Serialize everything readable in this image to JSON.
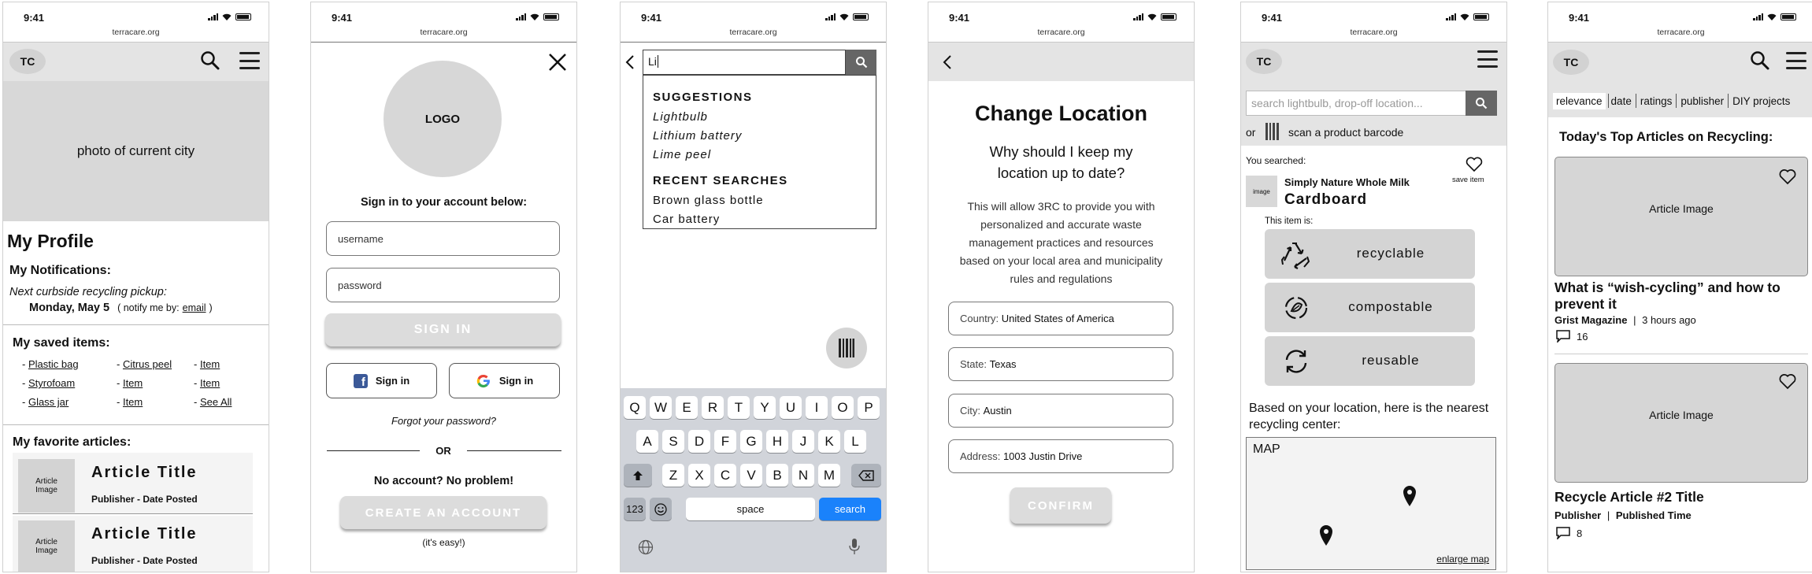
{
  "status": {
    "time": "9:41",
    "url": "terracare.org"
  },
  "profile": {
    "logo": "TC",
    "city_photo": "photo of current city",
    "title": "My Profile",
    "notifications_heading": "My Notifications:",
    "pickup_label": "Next curbside recycling pickup:",
    "pickup_date": "Monday, May 5",
    "notify_pre": "( notify me by:",
    "notify_link": "email",
    "notify_post": ")",
    "saved_heading": "My saved items:",
    "saved_items": [
      "Plastic bag",
      "Citrus peel",
      "Item",
      "Styrofoam",
      "Item",
      "Item",
      "Glass jar",
      "Item",
      "See All"
    ],
    "favorites_heading": "My favorite articles:",
    "articles": [
      {
        "image": "Article Image",
        "title": "Article Title",
        "meta": "Publisher - Date Posted"
      },
      {
        "image": "Article Image",
        "title": "Article Title",
        "meta": "Publisher - Date Posted"
      }
    ]
  },
  "signin": {
    "logo": "LOGO",
    "heading": "Sign in to your account below:",
    "username_placeholder": "username",
    "password_placeholder": "password",
    "signin_button": "SIGN IN",
    "facebook_button": "Sign in",
    "google_button": "Sign in",
    "forgot": "Forgot your password?",
    "or": "OR",
    "no_account": "No account? No problem!",
    "create_button": "CREATE AN ACCOUNT",
    "easy": "(it's easy!)"
  },
  "search": {
    "query": "Li",
    "suggestions_heading": "SUGGESTIONS",
    "suggestions": [
      "Lightbulb",
      "Lithium battery",
      "Lime peel"
    ],
    "recent_heading": "RECENT SEARCHES",
    "recent": [
      "Brown glass bottle",
      "Car battery"
    ],
    "keyboard": {
      "row1": [
        "Q",
        "W",
        "E",
        "R",
        "T",
        "Y",
        "U",
        "I",
        "O",
        "P"
      ],
      "row2": [
        "A",
        "S",
        "D",
        "F",
        "G",
        "H",
        "J",
        "K",
        "L"
      ],
      "row3": [
        "Z",
        "X",
        "C",
        "V",
        "B",
        "N",
        "M"
      ],
      "numbers": "123",
      "space": "space",
      "search": "search"
    }
  },
  "location": {
    "title": "Change Location",
    "why": "Why should I keep my location up to date?",
    "desc": "This will allow 3RC to provide you with personalized and accurate waste management practices and resources based on your local area and municipality rules and regulations",
    "fields": [
      {
        "label": "Country:",
        "value": "United States of America"
      },
      {
        "label": "State:",
        "value": "Texas"
      },
      {
        "label": "City:",
        "value": "Austin"
      },
      {
        "label": "Address:",
        "value": "1003 Justin Drive"
      }
    ],
    "confirm": "CONFIRM"
  },
  "result": {
    "logo": "TC",
    "search_placeholder": "search lightbulb, drop-off location...",
    "or": "or",
    "scan": "scan a product barcode",
    "you_searched": "You searched:",
    "image": "image",
    "product": "Simply Nature Whole Milk",
    "material": "Cardboard",
    "save": "save item",
    "this_item": "This item is:",
    "options": [
      "recyclable",
      "compostable",
      "reusable"
    ],
    "nearest": "Based on your location, here is the nearest recycling center:",
    "map": "MAP",
    "enlarge": "enlarge map"
  },
  "articles": {
    "logo": "TC",
    "filters": [
      "relevance",
      "date",
      "ratings",
      "publisher",
      "DIY projects"
    ],
    "heading": "Today's Top Articles on Recycling:",
    "items": [
      {
        "image": "Article Image",
        "title": "What is “wish-cycling” and how to prevent it",
        "publisher": "Grist Magazine",
        "time": "3 hours ago",
        "comments": "16"
      },
      {
        "image": "Article Image",
        "title": "Recycle Article #2 Title",
        "publisher": "Publisher",
        "time": "Published Time",
        "comments": "8"
      }
    ]
  }
}
